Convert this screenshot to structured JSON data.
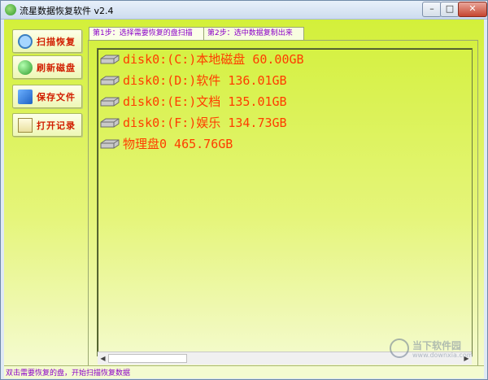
{
  "window": {
    "title": "流星数据恢复软件 v2.4",
    "controls": [
      "–",
      "□",
      "✕"
    ]
  },
  "sidebar": {
    "items": [
      {
        "label": "扫描恢复",
        "icon": "magnifier-icon"
      },
      {
        "label": "刷新磁盘",
        "icon": "refresh-disc-icon"
      },
      {
        "label": "保存文件",
        "icon": "save-icon"
      },
      {
        "label": "打开记录",
        "icon": "log-icon"
      }
    ]
  },
  "tabs": [
    {
      "label": "第1步：选择需要恢复的盘扫描",
      "active": true
    },
    {
      "label": "第2步：选中数据复制出来",
      "active": false
    }
  ],
  "disks": [
    {
      "label": "disk0:(C:)本地磁盘 60.00GB"
    },
    {
      "label": "disk0:(D:)软件 136.01GB"
    },
    {
      "label": "disk0:(E:)文档 135.01GB"
    },
    {
      "label": "disk0:(F:)娱乐 134.73GB"
    },
    {
      "label": "物理盘0 465.76GB"
    }
  ],
  "status": {
    "text": "双击需要恢复的盘，开始扫描恢复数据"
  },
  "scrollbar": {
    "left_arrow": "◀",
    "right_arrow": "▶"
  },
  "watermark": {
    "text": "当下软件园",
    "url": "www.downxia.com"
  },
  "colors": {
    "accent_text": "#ff3c00",
    "tab_text": "#8b00c9",
    "background_top": "#d3f03a"
  }
}
